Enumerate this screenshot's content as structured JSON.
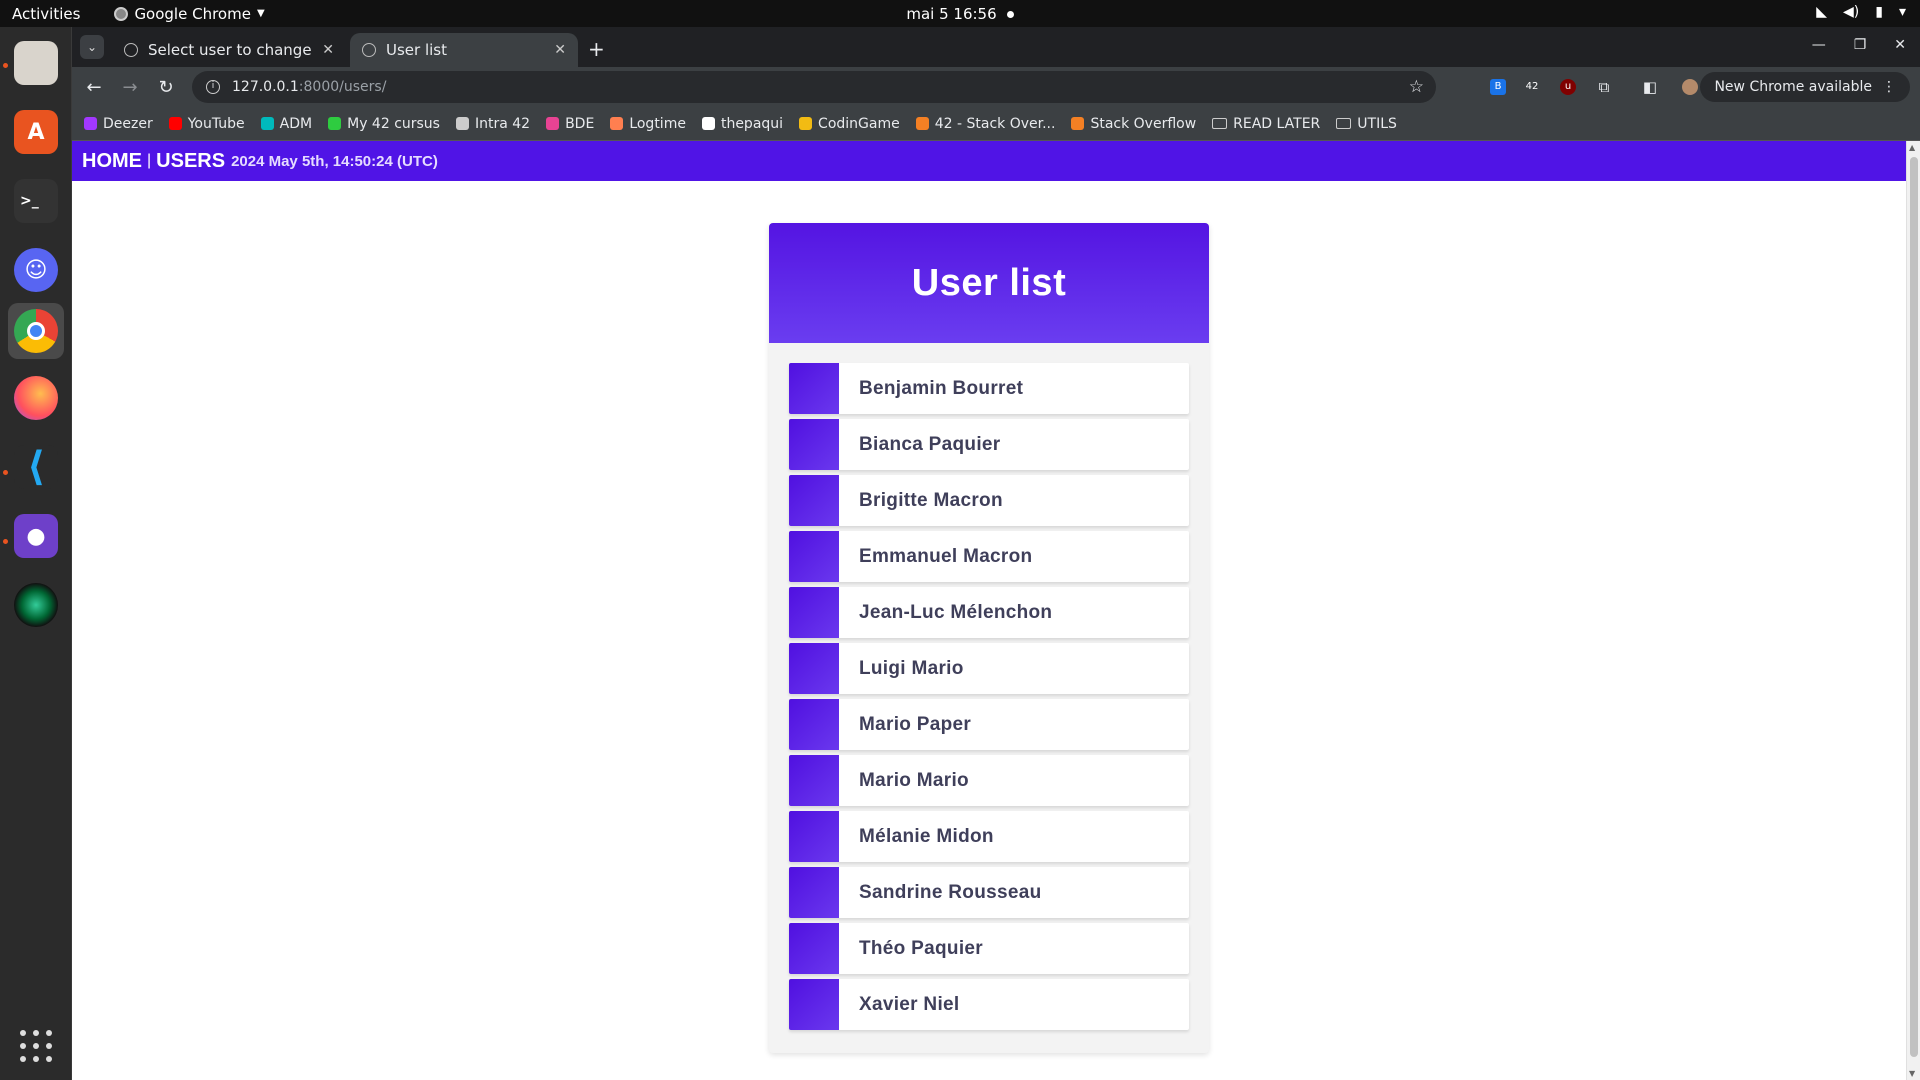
{
  "topbar": {
    "activities": "Activities",
    "app_name": "Google Chrome",
    "clock": "mai 5  16:56"
  },
  "browser": {
    "tabs": [
      {
        "title": "Select user to change | D",
        "active": false
      },
      {
        "title": "User list",
        "active": true
      }
    ],
    "url_host": "127.0.0.1",
    "url_path": ":8000/users/",
    "update_label": "New Chrome available",
    "bookmarks": [
      {
        "label": "Deezer",
        "color": "#a238ff"
      },
      {
        "label": "YouTube",
        "color": "#ff0000"
      },
      {
        "label": "ADM",
        "color": "#00babc"
      },
      {
        "label": "My 42 cursus",
        "color": "#2ecc40"
      },
      {
        "label": "Intra 42",
        "color": "#cccccc"
      },
      {
        "label": "BDE",
        "color": "#e84393"
      },
      {
        "label": "Logtime",
        "color": "#ff7f50"
      },
      {
        "label": "thepaqui",
        "color": "#ffffff"
      },
      {
        "label": "CodinGame",
        "color": "#f2bb13"
      },
      {
        "label": "42 - Stack Over...",
        "color": "#f48024"
      },
      {
        "label": "Stack Overflow",
        "color": "#f48024"
      },
      {
        "label": "READ LATER",
        "color": "folder"
      },
      {
        "label": "UTILS",
        "color": "folder"
      }
    ]
  },
  "page": {
    "nav": {
      "home": "HOME",
      "separator": "|",
      "users": "USERS",
      "timestamp": "2024 May 5th, 14:50:24 (UTC)"
    },
    "title": "User list",
    "users": [
      "Benjamin Bourret",
      "Bianca Paquier",
      "Brigitte Macron",
      "Emmanuel Macron",
      "Jean-Luc Mélenchon",
      "Luigi Mario",
      "Mario Paper",
      "Mario Mario",
      "Mélanie Midon",
      "Sandrine Rousseau",
      "Théo Paquier",
      "Xavier Niel"
    ],
    "accent_color": "#5014e6"
  }
}
